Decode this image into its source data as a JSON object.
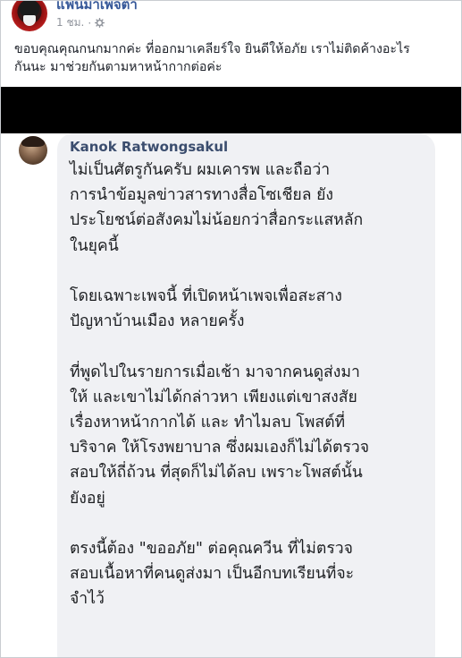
{
  "post": {
    "author": "แฟนมาเพจตำ",
    "timestamp": "1 ชม.",
    "visibility_icon": "gear-icon",
    "body_lines": [
      "ขอบคุณคุณกนกมากค่ะ ที่ออกมาเคลียร์ใจ ยินดีให้อภัย เราไม่ติดค้างอะไร",
      "กันนะ มาช่วยกันตามหาหน้ากากต่อค่ะ"
    ]
  },
  "comment": {
    "author": "Kanok Ratwongsakul",
    "paragraphs": [
      [
        "ไม่เป็นศัตรูกันครับ ผมเคารพ และถือว่า",
        "การนำข้อมูลข่าวสารทางสื่อโซเชียล ยัง",
        "ประโยชน์ต่อสังคมไม่น้อยกว่าสื่อกระแสหลัก",
        "ในยุคนี้"
      ],
      [
        "โดยเฉพาะเพจนี้ ที่เปิดหน้าเพจเพื่อสะสาง",
        "ปัญหาบ้านเมือง หลายครั้ง"
      ],
      [
        "ที่พูดไปในรายการเมื่อเช้า มาจากคนดูส่งมา",
        "ให้ และเขาไม่ได้กล่าวหา เพียงแต่เขาสงสัย",
        "เรื่องหาหน้ากากได้ และ ทำไมลบ โพสต์ที่",
        "บริจาค ให้โรงพยาบาล ซึ่งผมเองก็ไม่ได้ตรวจ",
        "สอบให้ถี่ถ้วน  ที่สุดก็ไม่ได้ลบ เพราะโพสต์นั้น",
        "ยังอยู่"
      ],
      [
        "ตรงนี้ต้อง \"ขออภัย\" ต่อคุณควีน ที่ไม่ตรวจ",
        "สอบเนื้อหาที่คนดูส่งมา เป็นอีกบทเรียนที่จะ",
        "จำไว้"
      ]
    ]
  },
  "colors": {
    "link": "#365899",
    "meta": "#90949c",
    "bubble": "#f0f1f4",
    "redaction": "#000000"
  }
}
